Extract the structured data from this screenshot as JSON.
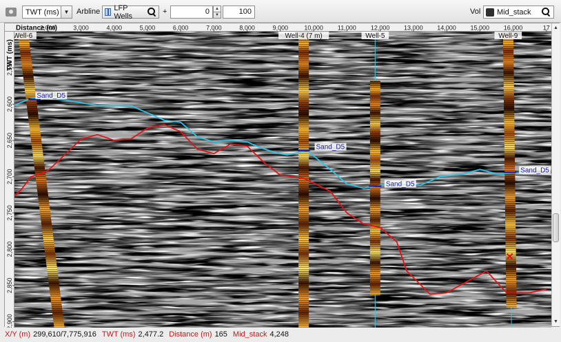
{
  "toolbar": {
    "domain_value": "TWT (ms)",
    "arbline_label": "Arbline",
    "wells_button_label": "LFP Wells",
    "plus_label": "+",
    "offset_value": "0",
    "range_value": "100",
    "vol_label": "Vol",
    "volume_value": "Mid_stack",
    "icons": [
      "camera-icon",
      "chevron-down-icon",
      "wells-icon",
      "search-icon",
      "spin-up-icon",
      "spin-down-icon",
      "volume-icon",
      "search-icon"
    ]
  },
  "view": {
    "x_axis_label": "Distance (m)",
    "y_axis_label": "TWT (ms)",
    "x_ticks": [
      {
        "label": "2,000",
        "value": 2000
      },
      {
        "label": "3,000",
        "value": 3000
      },
      {
        "label": "4,000",
        "value": 4000
      },
      {
        "label": "5,000",
        "value": 5000
      },
      {
        "label": "6,000",
        "value": 6000
      },
      {
        "label": "7,000",
        "value": 7000
      },
      {
        "label": "8,000",
        "value": 8000
      },
      {
        "label": "9,000",
        "value": 9000
      },
      {
        "label": "10,000",
        "value": 10000
      },
      {
        "label": "11,000",
        "value": 11000
      },
      {
        "label": "12,000",
        "value": 12000
      },
      {
        "label": "13,000",
        "value": 13000
      },
      {
        "label": "14,000",
        "value": 14000
      },
      {
        "label": "15,000",
        "value": 15000
      },
      {
        "label": "16,000",
        "value": 16000
      },
      {
        "label": "17",
        "value": 17000
      }
    ],
    "y_ticks": [
      {
        "label": "2,550",
        "value": 2550
      },
      {
        "label": "2,600",
        "value": 2600
      },
      {
        "label": "2,650",
        "value": 2650
      },
      {
        "label": "2,700",
        "value": 2700
      },
      {
        "label": "2,750",
        "value": 2750
      },
      {
        "label": "2,800",
        "value": 2800
      },
      {
        "label": "2,850",
        "value": 2850
      },
      {
        "label": "2,900",
        "value": 2900
      }
    ],
    "wells": [
      {
        "name": "Well-6",
        "x_top": 1250,
        "t_top": 2500,
        "x_bottom": 2350,
        "t_bottom": 2908
      },
      {
        "name": "Well-4 (7 m)",
        "x_top": 9700,
        "t_top": 2500,
        "x_bottom": 9700,
        "t_bottom": 2908
      },
      {
        "name": "Well-5",
        "x_top": 11850,
        "t_top": 2568,
        "x_bottom": 11850,
        "t_bottom": 2863
      },
      {
        "name": "Well-9",
        "x_top": 15850,
        "t_top": 2500,
        "x_bottom": 15950,
        "t_bottom": 2880
      }
    ],
    "horizon_cyan": {
      "color": "#2cc4e8",
      "points": [
        [
          800,
          2605
        ],
        [
          1500,
          2592
        ],
        [
          2000,
          2590
        ],
        [
          3000,
          2598
        ],
        [
          3500,
          2602
        ],
        [
          4500,
          2602
        ],
        [
          5000,
          2612
        ],
        [
          5500,
          2622
        ],
        [
          6000,
          2625
        ],
        [
          6500,
          2645
        ],
        [
          7000,
          2652
        ],
        [
          7500,
          2650
        ],
        [
          8000,
          2652
        ],
        [
          8400,
          2660
        ],
        [
          8800,
          2666
        ],
        [
          9200,
          2670
        ],
        [
          9800,
          2664
        ],
        [
          10500,
          2690
        ],
        [
          11000,
          2710
        ],
        [
          11500,
          2716
        ],
        [
          12000,
          2712
        ],
        [
          12800,
          2708
        ],
        [
          13200,
          2712
        ],
        [
          13800,
          2700
        ],
        [
          14500,
          2696
        ],
        [
          15000,
          2690
        ],
        [
          15500,
          2696
        ],
        [
          16000,
          2695
        ],
        [
          16400,
          2694
        ]
      ]
    },
    "horizon_red": {
      "color": "#e41212",
      "points": [
        [
          800,
          2735
        ],
        [
          1200,
          2718
        ],
        [
          1500,
          2700
        ],
        [
          2000,
          2692
        ],
        [
          2600,
          2666
        ],
        [
          3000,
          2648
        ],
        [
          3500,
          2642
        ],
        [
          4000,
          2650
        ],
        [
          4500,
          2648
        ],
        [
          5000,
          2633
        ],
        [
          5500,
          2628
        ],
        [
          6000,
          2638
        ],
        [
          6500,
          2662
        ],
        [
          7000,
          2668
        ],
        [
          7500,
          2655
        ],
        [
          8000,
          2658
        ],
        [
          8500,
          2680
        ],
        [
          9000,
          2698
        ],
        [
          9700,
          2702
        ],
        [
          10500,
          2720
        ],
        [
          11000,
          2750
        ],
        [
          11500,
          2765
        ],
        [
          12000,
          2770
        ],
        [
          12500,
          2790
        ],
        [
          12800,
          2830
        ],
        [
          13500,
          2862
        ],
        [
          14000,
          2860
        ],
        [
          14800,
          2840
        ],
        [
          15200,
          2830
        ],
        [
          15800,
          2860
        ],
        [
          16500,
          2860
        ],
        [
          17000,
          2855
        ]
      ]
    },
    "horizon_labels": [
      {
        "text": "Sand_D5",
        "x": 1650,
        "t": 2591
      },
      {
        "text": "Sand_D5",
        "x": 10050,
        "t": 2662
      },
      {
        "text": "Sand_D5",
        "x": 12150,
        "t": 2713
      },
      {
        "text": "Sand_D5",
        "x": 16200,
        "t": 2694
      }
    ],
    "pick_markers": [
      {
        "x": 1600,
        "t": 2593
      },
      {
        "x": 9700,
        "t": 2664
      },
      {
        "x": 11850,
        "t": 2713
      },
      {
        "x": 15900,
        "t": 2694
      }
    ],
    "cross_marker": {
      "x": 15900,
      "t": 2810,
      "color": "#e41212"
    }
  },
  "status": {
    "xy_label": "X/Y (m)",
    "xy_value": "299,610/7,775,916",
    "twt_label": "TWT (ms)",
    "twt_value": "2,477.2",
    "dist_label": "Distance (m)",
    "dist_value": "165",
    "vol_label": "Mid_stack",
    "vol_value": "4,248"
  }
}
